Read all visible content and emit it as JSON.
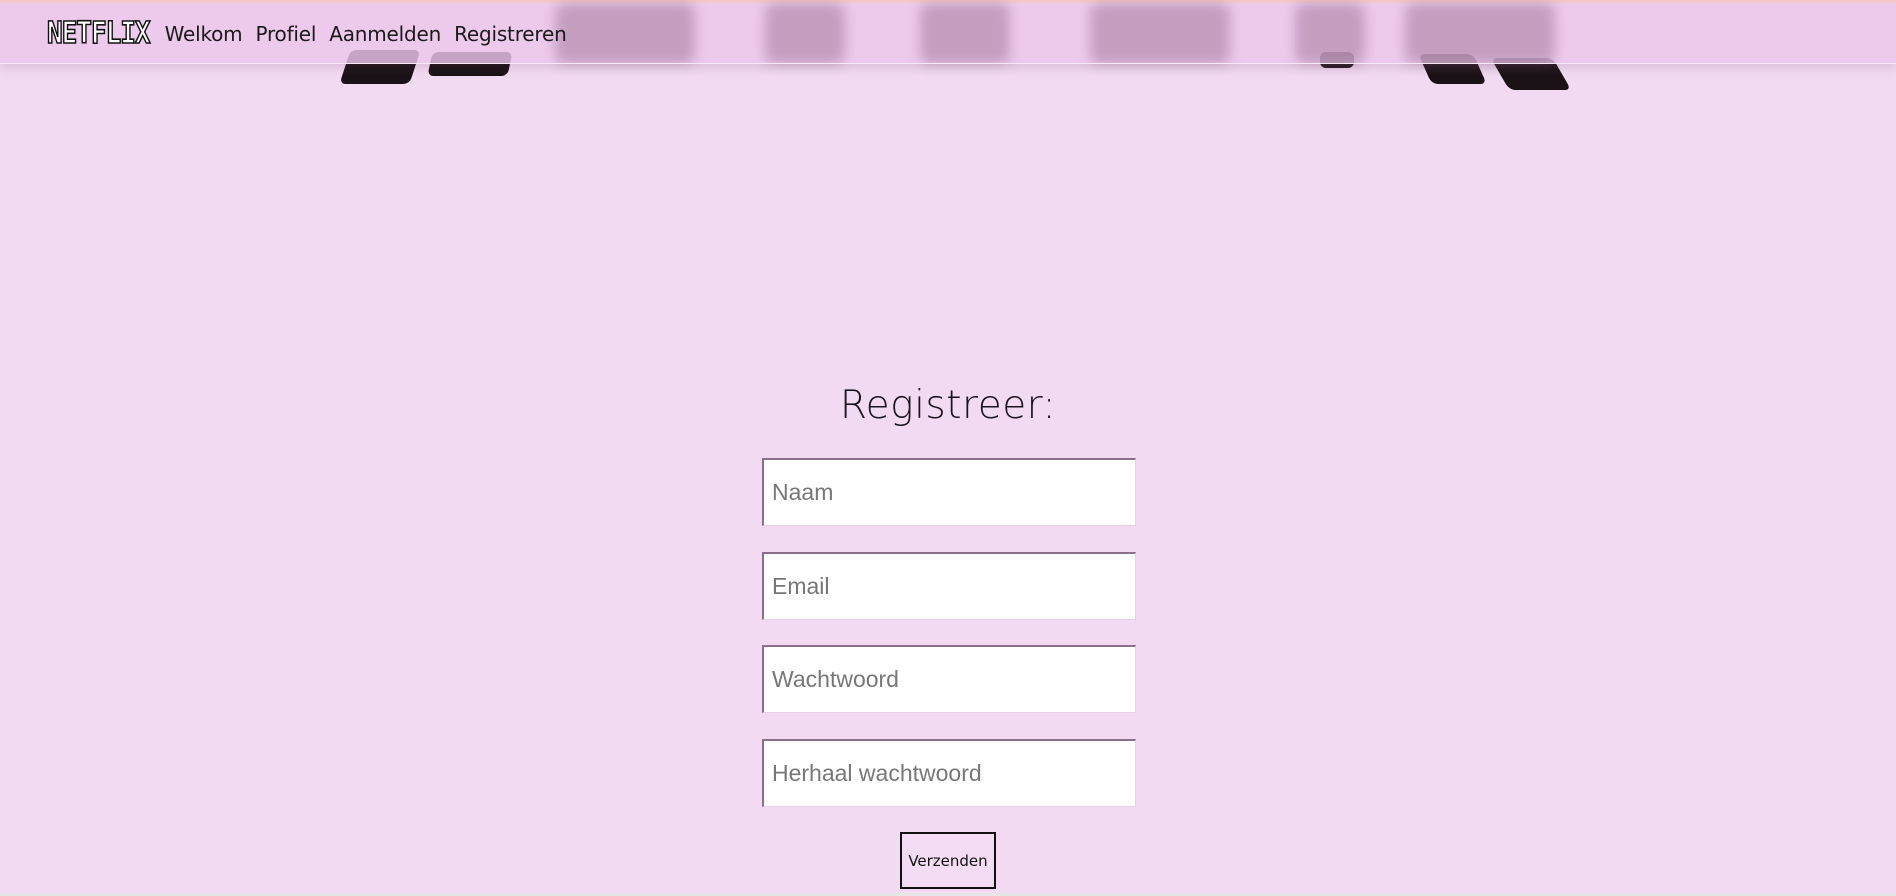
{
  "navbar": {
    "logo": "NETFLIX",
    "links": [
      "Welkom",
      "Profiel",
      "Aanmelden",
      "Registreren"
    ]
  },
  "form": {
    "title": "Registreer:",
    "fields": {
      "name_placeholder": "Naam",
      "email_placeholder": "Email",
      "password_placeholder": "Wachtwoord",
      "repeat_password_placeholder": "Herhaal wachtwoord"
    },
    "submit_label": "Verzenden"
  },
  "colors": {
    "background": "#f2dbf2",
    "navbar": "#ecc4ea",
    "navbar_top_border": "#f4c7c9"
  }
}
